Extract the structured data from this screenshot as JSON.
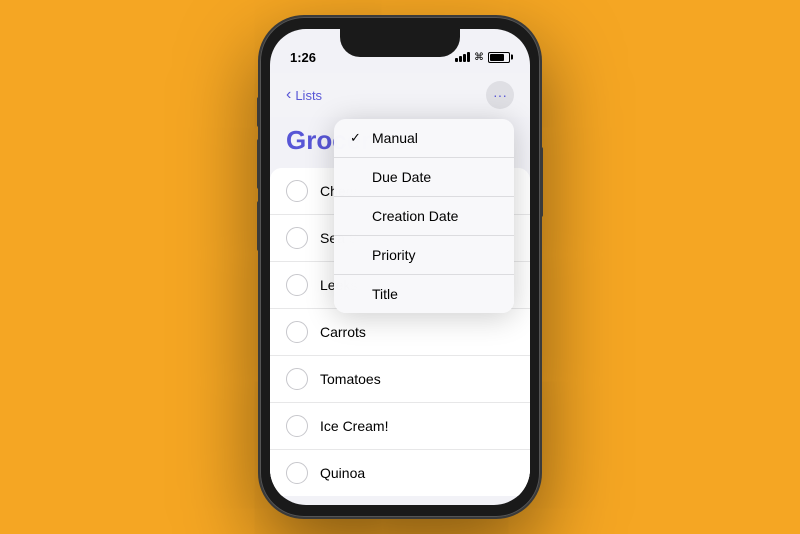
{
  "background_color": "#F5A623",
  "phone": {
    "status_bar": {
      "time": "1:26",
      "signal_label": "signal",
      "wifi_label": "wifi",
      "battery_label": "battery"
    },
    "nav": {
      "back_label": "Lists",
      "more_icon": "•••"
    },
    "screen": {
      "title": "Grocery",
      "items": [
        {
          "text": "Cheese"
        },
        {
          "text": "Sea Salt"
        },
        {
          "text": "Leeks"
        },
        {
          "text": "Carrots"
        },
        {
          "text": "Tomatoes"
        },
        {
          "text": "Ice Cream!"
        },
        {
          "text": "Quinoa"
        },
        {
          "text": "..."
        }
      ]
    },
    "dropdown": {
      "items": [
        {
          "label": "Manual",
          "checked": true
        },
        {
          "label": "Due Date",
          "checked": false
        },
        {
          "label": "Creation Date",
          "checked": false
        },
        {
          "label": "Priority",
          "checked": false
        },
        {
          "label": "Title",
          "checked": false
        }
      ]
    }
  }
}
